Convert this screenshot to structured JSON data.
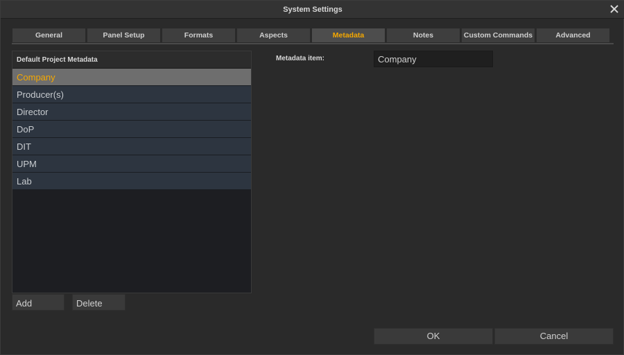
{
  "window": {
    "title": "System Settings"
  },
  "tabs": [
    {
      "label": "General"
    },
    {
      "label": "Panel Setup"
    },
    {
      "label": "Formats"
    },
    {
      "label": "Aspects"
    },
    {
      "label": "Metadata",
      "active": true
    },
    {
      "label": "Notes"
    },
    {
      "label": "Custom Commands"
    },
    {
      "label": "Advanced"
    }
  ],
  "metadata_list": {
    "header": "Default Project Metadata",
    "items": [
      {
        "label": "Company",
        "selected": true
      },
      {
        "label": "Producer(s)"
      },
      {
        "label": "Director"
      },
      {
        "label": "DoP"
      },
      {
        "label": "DIT"
      },
      {
        "label": "UPM"
      },
      {
        "label": "Lab"
      }
    ],
    "add_label": "Add",
    "delete_label": "Delete"
  },
  "detail": {
    "item_label": "Metadata item:",
    "item_value": "Company"
  },
  "dialog": {
    "ok_label": "OK",
    "cancel_label": "Cancel"
  },
  "colors": {
    "accent": "#f5a800",
    "background": "#2a2a2a",
    "list_item": "#2d3540",
    "selected_item": "#6e6e6e"
  },
  "icons": {
    "close": "close-icon"
  }
}
